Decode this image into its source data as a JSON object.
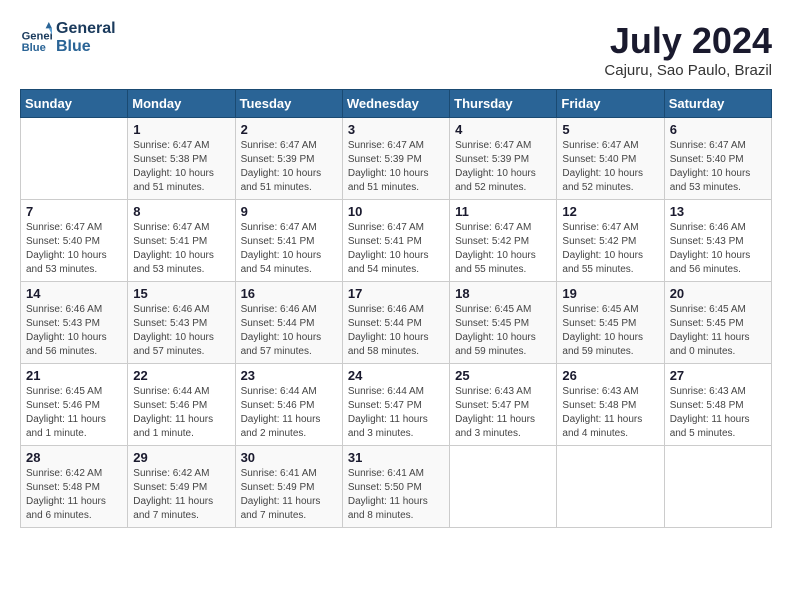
{
  "header": {
    "logo_line1": "General",
    "logo_line2": "Blue",
    "month": "July 2024",
    "location": "Cajuru, Sao Paulo, Brazil"
  },
  "weekdays": [
    "Sunday",
    "Monday",
    "Tuesday",
    "Wednesday",
    "Thursday",
    "Friday",
    "Saturday"
  ],
  "weeks": [
    [
      {
        "day": "",
        "sunrise": "",
        "sunset": "",
        "daylight": ""
      },
      {
        "day": "1",
        "sunrise": "Sunrise: 6:47 AM",
        "sunset": "Sunset: 5:38 PM",
        "daylight": "Daylight: 10 hours and 51 minutes."
      },
      {
        "day": "2",
        "sunrise": "Sunrise: 6:47 AM",
        "sunset": "Sunset: 5:39 PM",
        "daylight": "Daylight: 10 hours and 51 minutes."
      },
      {
        "day": "3",
        "sunrise": "Sunrise: 6:47 AM",
        "sunset": "Sunset: 5:39 PM",
        "daylight": "Daylight: 10 hours and 51 minutes."
      },
      {
        "day": "4",
        "sunrise": "Sunrise: 6:47 AM",
        "sunset": "Sunset: 5:39 PM",
        "daylight": "Daylight: 10 hours and 52 minutes."
      },
      {
        "day": "5",
        "sunrise": "Sunrise: 6:47 AM",
        "sunset": "Sunset: 5:40 PM",
        "daylight": "Daylight: 10 hours and 52 minutes."
      },
      {
        "day": "6",
        "sunrise": "Sunrise: 6:47 AM",
        "sunset": "Sunset: 5:40 PM",
        "daylight": "Daylight: 10 hours and 53 minutes."
      }
    ],
    [
      {
        "day": "7",
        "sunrise": "Sunrise: 6:47 AM",
        "sunset": "Sunset: 5:40 PM",
        "daylight": "Daylight: 10 hours and 53 minutes."
      },
      {
        "day": "8",
        "sunrise": "Sunrise: 6:47 AM",
        "sunset": "Sunset: 5:41 PM",
        "daylight": "Daylight: 10 hours and 53 minutes."
      },
      {
        "day": "9",
        "sunrise": "Sunrise: 6:47 AM",
        "sunset": "Sunset: 5:41 PM",
        "daylight": "Daylight: 10 hours and 54 minutes."
      },
      {
        "day": "10",
        "sunrise": "Sunrise: 6:47 AM",
        "sunset": "Sunset: 5:41 PM",
        "daylight": "Daylight: 10 hours and 54 minutes."
      },
      {
        "day": "11",
        "sunrise": "Sunrise: 6:47 AM",
        "sunset": "Sunset: 5:42 PM",
        "daylight": "Daylight: 10 hours and 55 minutes."
      },
      {
        "day": "12",
        "sunrise": "Sunrise: 6:47 AM",
        "sunset": "Sunset: 5:42 PM",
        "daylight": "Daylight: 10 hours and 55 minutes."
      },
      {
        "day": "13",
        "sunrise": "Sunrise: 6:46 AM",
        "sunset": "Sunset: 5:43 PM",
        "daylight": "Daylight: 10 hours and 56 minutes."
      }
    ],
    [
      {
        "day": "14",
        "sunrise": "Sunrise: 6:46 AM",
        "sunset": "Sunset: 5:43 PM",
        "daylight": "Daylight: 10 hours and 56 minutes."
      },
      {
        "day": "15",
        "sunrise": "Sunrise: 6:46 AM",
        "sunset": "Sunset: 5:43 PM",
        "daylight": "Daylight: 10 hours and 57 minutes."
      },
      {
        "day": "16",
        "sunrise": "Sunrise: 6:46 AM",
        "sunset": "Sunset: 5:44 PM",
        "daylight": "Daylight: 10 hours and 57 minutes."
      },
      {
        "day": "17",
        "sunrise": "Sunrise: 6:46 AM",
        "sunset": "Sunset: 5:44 PM",
        "daylight": "Daylight: 10 hours and 58 minutes."
      },
      {
        "day": "18",
        "sunrise": "Sunrise: 6:45 AM",
        "sunset": "Sunset: 5:45 PM",
        "daylight": "Daylight: 10 hours and 59 minutes."
      },
      {
        "day": "19",
        "sunrise": "Sunrise: 6:45 AM",
        "sunset": "Sunset: 5:45 PM",
        "daylight": "Daylight: 10 hours and 59 minutes."
      },
      {
        "day": "20",
        "sunrise": "Sunrise: 6:45 AM",
        "sunset": "Sunset: 5:45 PM",
        "daylight": "Daylight: 11 hours and 0 minutes."
      }
    ],
    [
      {
        "day": "21",
        "sunrise": "Sunrise: 6:45 AM",
        "sunset": "Sunset: 5:46 PM",
        "daylight": "Daylight: 11 hours and 1 minute."
      },
      {
        "day": "22",
        "sunrise": "Sunrise: 6:44 AM",
        "sunset": "Sunset: 5:46 PM",
        "daylight": "Daylight: 11 hours and 1 minute."
      },
      {
        "day": "23",
        "sunrise": "Sunrise: 6:44 AM",
        "sunset": "Sunset: 5:46 PM",
        "daylight": "Daylight: 11 hours and 2 minutes."
      },
      {
        "day": "24",
        "sunrise": "Sunrise: 6:44 AM",
        "sunset": "Sunset: 5:47 PM",
        "daylight": "Daylight: 11 hours and 3 minutes."
      },
      {
        "day": "25",
        "sunrise": "Sunrise: 6:43 AM",
        "sunset": "Sunset: 5:47 PM",
        "daylight": "Daylight: 11 hours and 3 minutes."
      },
      {
        "day": "26",
        "sunrise": "Sunrise: 6:43 AM",
        "sunset": "Sunset: 5:48 PM",
        "daylight": "Daylight: 11 hours and 4 minutes."
      },
      {
        "day": "27",
        "sunrise": "Sunrise: 6:43 AM",
        "sunset": "Sunset: 5:48 PM",
        "daylight": "Daylight: 11 hours and 5 minutes."
      }
    ],
    [
      {
        "day": "28",
        "sunrise": "Sunrise: 6:42 AM",
        "sunset": "Sunset: 5:48 PM",
        "daylight": "Daylight: 11 hours and 6 minutes."
      },
      {
        "day": "29",
        "sunrise": "Sunrise: 6:42 AM",
        "sunset": "Sunset: 5:49 PM",
        "daylight": "Daylight: 11 hours and 7 minutes."
      },
      {
        "day": "30",
        "sunrise": "Sunrise: 6:41 AM",
        "sunset": "Sunset: 5:49 PM",
        "daylight": "Daylight: 11 hours and 7 minutes."
      },
      {
        "day": "31",
        "sunrise": "Sunrise: 6:41 AM",
        "sunset": "Sunset: 5:50 PM",
        "daylight": "Daylight: 11 hours and 8 minutes."
      },
      {
        "day": "",
        "sunrise": "",
        "sunset": "",
        "daylight": ""
      },
      {
        "day": "",
        "sunrise": "",
        "sunset": "",
        "daylight": ""
      },
      {
        "day": "",
        "sunrise": "",
        "sunset": "",
        "daylight": ""
      }
    ]
  ]
}
